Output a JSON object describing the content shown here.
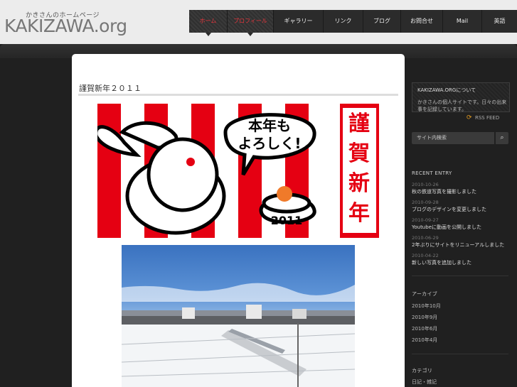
{
  "logo": {
    "tagline": "かきさんのホームページ",
    "text": "KAKIZAWA.org"
  },
  "nav": [
    {
      "label": "ホーム"
    },
    {
      "label": "プロフィール"
    },
    {
      "label": "ギャラリー"
    },
    {
      "label": "リンク"
    },
    {
      "label": "ブログ"
    },
    {
      "label": "お問合せ"
    },
    {
      "label": "Mail"
    },
    {
      "label": "英語"
    }
  ],
  "post": {
    "title": "謹賀新年２０１１",
    "greeting": {
      "bubble_line1": "本年も",
      "bubble_line2": "よろしく!",
      "year": "2011",
      "vertical": [
        "謹",
        "賀",
        "新",
        "年"
      ]
    }
  },
  "sidebar": {
    "about_title": "KAKIZAWA.ORGについて",
    "about_desc": "かきさんの個人サイトです。日々の出来事を記録しています。",
    "rss_label": "RSS FEED",
    "search_placeholder": "サイト内検索",
    "recent_title": "RECENT ENTRY",
    "recent": [
      {
        "date": "2010-10-26",
        "title": "秋の鉄道写真を撮影しました"
      },
      {
        "date": "2010-09-28",
        "title": "ブログのデザインを変更しました"
      },
      {
        "date": "2010-09-27",
        "title": "Youtubeに動画を公開しました"
      },
      {
        "date": "2010-06-29",
        "title": "2年ぶりにサイトをリニューアルしました"
      },
      {
        "date": "2010-04-22",
        "title": "新しい写真を追加しました"
      }
    ],
    "archive_title": "アーカイブ",
    "archives": [
      "2010年10月",
      "2010年9月",
      "2010年6月",
      "2010年4月"
    ],
    "category_title": "カテゴリ",
    "category_first": "日記・雑記"
  },
  "colors": {
    "accent": "#e7343b",
    "stripe": "#e50012",
    "dark": "#202020"
  }
}
